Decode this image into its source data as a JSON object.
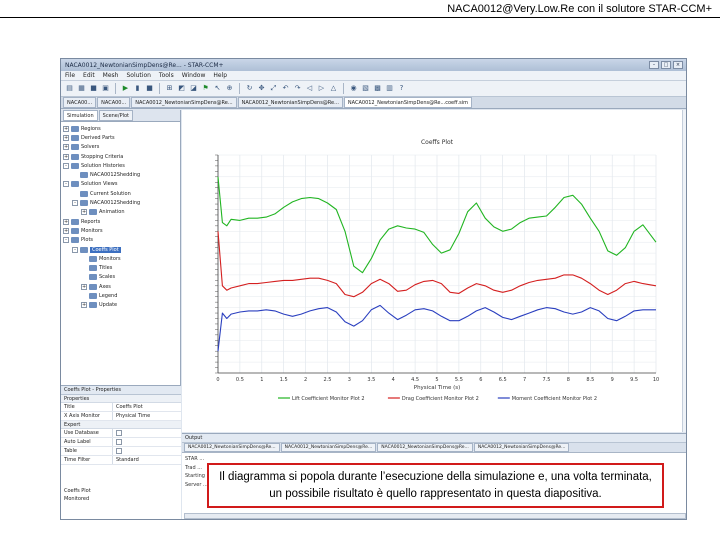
{
  "slide": {
    "title": "NACA0012@Very.Low.Re con il solutore STAR-CCM+",
    "caption": "Il diagramma si popola durante l’esecuzione della simulazione e, una volta terminata, un possibile risultato è quello rappresentato in questa diapositiva."
  },
  "app": {
    "window_title": "NACA0012_NewtonianSimpDens@Re... - STAR-CCM+",
    "menu": [
      "File",
      "Edit",
      "Mesh",
      "Solution",
      "Tools",
      "Window",
      "Help"
    ],
    "doc_tabs": [
      "NACA00...",
      "NACA00...",
      "NACA0012_NewtonianSimpDens@Re...",
      "NACA0012_NewtonianSimpDens@Re...",
      "NACA0012_NewtonianSimpDens@Re...coeff.sim"
    ],
    "panel_tabs": [
      "Simulation",
      "Scene/Plot"
    ],
    "tree": [
      {
        "label": "Regions",
        "level": 0,
        "expander": "+"
      },
      {
        "label": "Derived Parts",
        "level": 0,
        "expander": "+"
      },
      {
        "label": "Solvers",
        "level": 0,
        "expander": "+"
      },
      {
        "label": "Stopping Criteria",
        "level": 0,
        "expander": "+"
      },
      {
        "label": "Solution Histories",
        "level": 0,
        "expander": "-"
      },
      {
        "label": "NACA0012Shedding",
        "level": 1,
        "expander": ""
      },
      {
        "label": "Solution Views",
        "level": 0,
        "expander": "-"
      },
      {
        "label": "Current Solution",
        "level": 1,
        "expander": ""
      },
      {
        "label": "NACA0012Shedding",
        "level": 1,
        "expander": "-"
      },
      {
        "label": "Animation",
        "level": 2,
        "expander": "+"
      },
      {
        "label": "Reports",
        "level": 0,
        "expander": "+"
      },
      {
        "label": "Monitors",
        "level": 0,
        "expander": "+"
      },
      {
        "label": "Plots",
        "level": 0,
        "expander": "-"
      },
      {
        "label": "Coeffs Plot",
        "level": 1,
        "expander": "-",
        "selected": true
      },
      {
        "label": "Monitors",
        "level": 2,
        "expander": ""
      },
      {
        "label": "Titles",
        "level": 2,
        "expander": ""
      },
      {
        "label": "Scales",
        "level": 2,
        "expander": ""
      },
      {
        "label": "Axes",
        "level": 2,
        "expander": "+"
      },
      {
        "label": "Legend",
        "level": 2,
        "expander": ""
      },
      {
        "label": "Update",
        "level": 2,
        "expander": "+"
      }
    ],
    "properties": {
      "header": "Coeffs Plot - Properties",
      "group1": "Properties",
      "rows1": [
        {
          "key": "Title",
          "value": "Coeffs Plot"
        },
        {
          "key": "X Axis Monitor",
          "value": "Physical Time"
        }
      ],
      "group2": "Expert",
      "rows2": [
        {
          "key": "Use Database",
          "value": ""
        },
        {
          "key": "Auto Label",
          "value": ""
        },
        {
          "key": "Table",
          "value": ""
        },
        {
          "key": "Time Filter",
          "value": "Standard"
        }
      ],
      "footer_lines": [
        "Coeffs Plot",
        "Monitored"
      ]
    },
    "output": {
      "header": "Output",
      "tabs": [
        "NACA0012_NewtonianSimpDens@Re...",
        "NACA0012_NewtonianSimpDens@Re...",
        "NACA0012_NewtonianSimpDens@Re...",
        "NACA0012_NewtonianSimpDens@Re..."
      ],
      "lines": [
        "STAR ...",
        "Trad ...",
        "Starting ...",
        "Server ..."
      ]
    }
  },
  "chart_data": {
    "type": "line",
    "title": "Coeffs Plot",
    "xlabel": "Physical Time (s)",
    "ylabel": "",
    "xlim": [
      0,
      10
    ],
    "ylim": [
      -0.6,
      1.4
    ],
    "xticks": [
      "0",
      "0.5",
      "1",
      "1.5",
      "2",
      "2.5",
      "3",
      "3.5",
      "4",
      "4.5",
      "5",
      "5.5",
      "6",
      "6.5",
      "7",
      "7.5",
      "8",
      "8.5",
      "9",
      "9.5",
      "10"
    ],
    "grid": true,
    "legend_position": "bottom",
    "x": [
      0,
      0.1,
      0.2,
      0.3,
      0.5,
      0.7,
      0.9,
      1.1,
      1.3,
      1.5,
      1.7,
      1.9,
      2.1,
      2.3,
      2.5,
      2.7,
      2.9,
      3.1,
      3.3,
      3.5,
      3.7,
      3.9,
      4.1,
      4.3,
      4.5,
      4.7,
      4.9,
      5.1,
      5.3,
      5.5,
      5.7,
      5.9,
      6.1,
      6.3,
      6.5,
      6.7,
      6.9,
      7.1,
      7.3,
      7.5,
      7.7,
      7.9,
      8.1,
      8.3,
      8.5,
      8.7,
      8.9,
      9.1,
      9.3,
      9.5,
      9.7,
      10
    ],
    "series": [
      {
        "name": "Lift Coefficient Monitor Plot 2",
        "color": "#22b522",
        "values": [
          1.2,
          0.78,
          0.75,
          0.81,
          0.8,
          0.82,
          0.82,
          0.83,
          0.86,
          0.92,
          0.97,
          1.0,
          1.01,
          1.0,
          0.96,
          0.9,
          0.7,
          0.38,
          0.32,
          0.45,
          0.62,
          0.72,
          0.75,
          0.73,
          0.72,
          0.69,
          0.58,
          0.5,
          0.53,
          0.68,
          0.88,
          0.96,
          0.82,
          0.74,
          0.7,
          0.72,
          0.78,
          0.82,
          0.83,
          0.84,
          0.92,
          1.01,
          1.03,
          0.95,
          0.82,
          0.7,
          0.52,
          0.48,
          0.55,
          0.7,
          0.76,
          0.6
        ]
      },
      {
        "name": "Drag Coefficient Monitor Plot 2",
        "color": "#d42020",
        "values": [
          0.7,
          0.2,
          0.16,
          0.18,
          0.2,
          0.22,
          0.22,
          0.23,
          0.24,
          0.25,
          0.25,
          0.26,
          0.27,
          0.27,
          0.25,
          0.22,
          0.12,
          0.1,
          0.14,
          0.22,
          0.26,
          0.22,
          0.15,
          0.16,
          0.21,
          0.24,
          0.25,
          0.22,
          0.14,
          0.13,
          0.18,
          0.22,
          0.2,
          0.16,
          0.14,
          0.16,
          0.2,
          0.23,
          0.25,
          0.26,
          0.27,
          0.3,
          0.3,
          0.27,
          0.22,
          0.16,
          0.12,
          0.16,
          0.22,
          0.24,
          0.22,
          0.2
        ]
      },
      {
        "name": "Moment Coefficient Monitor Plot 2",
        "color": "#2a3fbf",
        "values": [
          -0.4,
          -0.05,
          -0.1,
          -0.06,
          -0.04,
          -0.03,
          -0.03,
          -0.02,
          -0.03,
          -0.06,
          -0.08,
          -0.06,
          -0.03,
          -0.01,
          0.0,
          -0.04,
          -0.13,
          -0.17,
          -0.12,
          -0.02,
          0.02,
          -0.05,
          -0.11,
          -0.07,
          -0.02,
          -0.01,
          -0.03,
          -0.08,
          -0.12,
          -0.12,
          -0.08,
          -0.03,
          0.0,
          -0.04,
          -0.09,
          -0.11,
          -0.08,
          -0.05,
          -0.02,
          0.0,
          -0.01,
          -0.04,
          -0.06,
          -0.04,
          0.0,
          -0.03,
          -0.1,
          -0.12,
          -0.08,
          -0.03,
          -0.02,
          -0.02
        ]
      }
    ]
  }
}
